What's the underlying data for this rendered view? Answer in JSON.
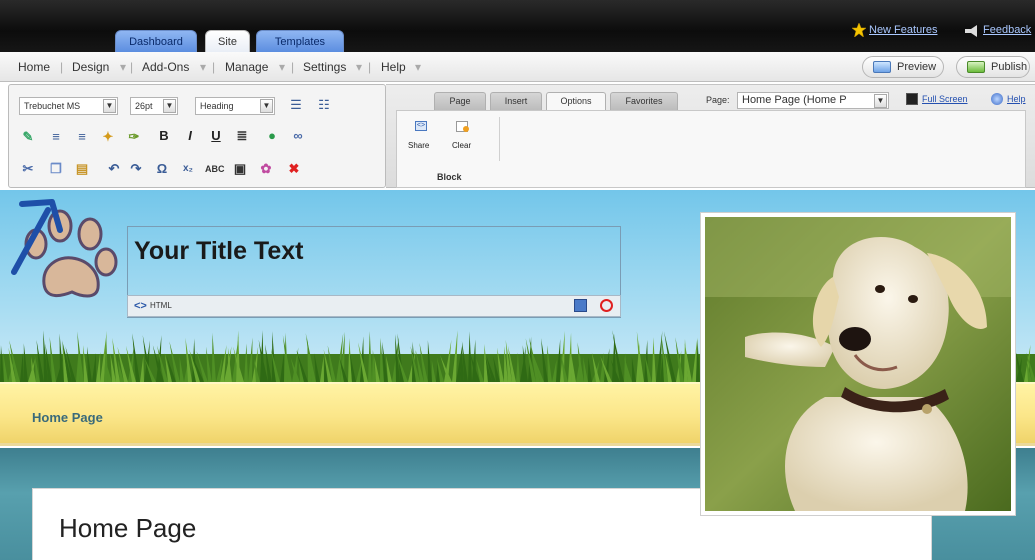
{
  "topbar": {
    "tabs": [
      {
        "label": "Dashboard"
      },
      {
        "label": "Site"
      },
      {
        "label": "Templates"
      }
    ],
    "links": [
      {
        "label": "New Features",
        "icon": "star-icon"
      },
      {
        "label": "Feedback",
        "icon": "megaphone-icon"
      }
    ]
  },
  "menubar": {
    "items": [
      "Home",
      "Design",
      "Add-Ons",
      "Manage",
      "Settings",
      "Help"
    ],
    "preview_label": "Preview",
    "publish_label": "Publish"
  },
  "editor": {
    "font_family": "Trebuchet MS",
    "font_size": "26pt",
    "paragraph_style": "Heading",
    "row2_icons": [
      "paint-brush-icon",
      "align-left-icon",
      "align-center-icon",
      "align-right-icon",
      "highlight-icon",
      "brush-icon",
      "bold-icon",
      "italic-icon",
      "underline-icon",
      "list-options-icon",
      "globe-link-icon",
      "link-icon"
    ],
    "row3_icons": [
      "cut-icon",
      "copy-icon",
      "paste-icon",
      "undo-icon",
      "redo-icon",
      "special-char-icon",
      "subscript-icon",
      "spellcheck-icon",
      "text-block-icon",
      "paint-icon",
      "delete-icon"
    ]
  },
  "ribbon": {
    "tabs": [
      "Page",
      "Insert",
      "Options",
      "Favorites"
    ],
    "active_tab": "Options",
    "page_label": "Page:",
    "page_select": "Home Page (Home P",
    "fullscreen_label": "Full Screen",
    "help_label": "Help",
    "share_label": "Share",
    "clear_label": "Clear",
    "group_label": "Block"
  },
  "site": {
    "title_text": "Your Title Text",
    "html_label": "HTML",
    "nav_home": "Home Page",
    "content_heading": "Home Page"
  },
  "colors": {
    "accent": "#1e4fa8",
    "tab_blue": "#6b9be8",
    "nav_text": "#3a6a7a",
    "yellow_band": "#fbe689",
    "teal_band": "#4b8f9e"
  }
}
